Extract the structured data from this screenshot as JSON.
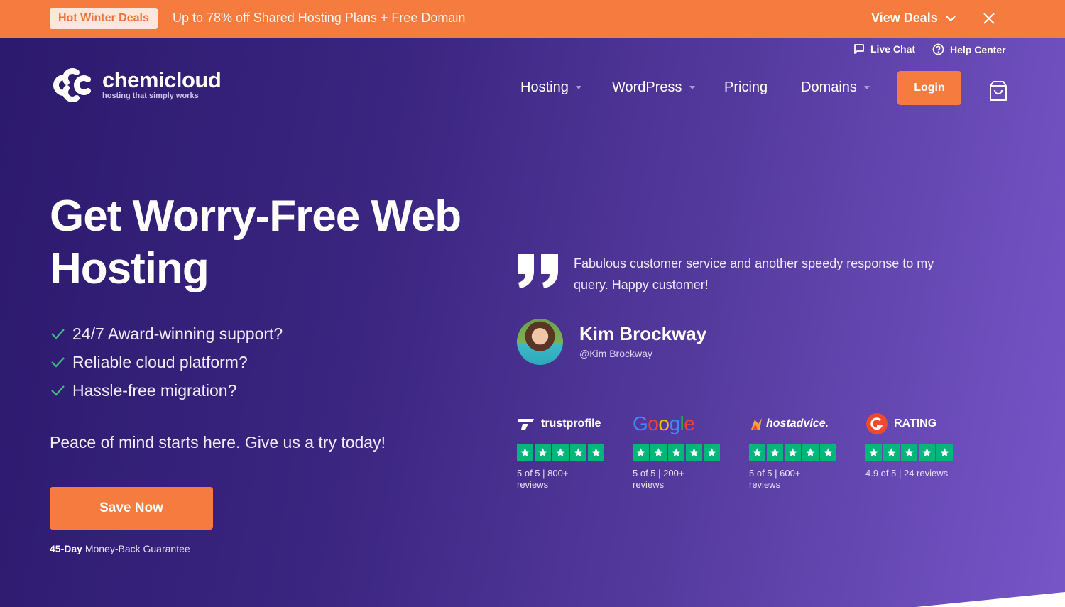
{
  "promo": {
    "badge": "Hot Winter Deals",
    "text": "Up to 78% off Shared Hosting Plans + Free Domain",
    "view_deals": "View Deals",
    "icons": {
      "chevron": "chevron-down-icon",
      "close": "close-icon"
    }
  },
  "utility": {
    "live_chat": "Live Chat",
    "help_center": "Help Center"
  },
  "logo": {
    "name": "chemicloud",
    "tagline": "hosting that simply works"
  },
  "nav": {
    "items": [
      {
        "label": "Hosting",
        "dropdown": true
      },
      {
        "label": "WordPress",
        "dropdown": true
      },
      {
        "label": "Pricing",
        "dropdown": false
      },
      {
        "label": "Domains",
        "dropdown": true
      }
    ],
    "login": "Login",
    "cart_icon": "shopping-bag-icon"
  },
  "hero": {
    "headline": "Get Worry-Free Web Hosting",
    "checks": [
      "24/7 Award-winning support?",
      "Reliable cloud platform?",
      "Hassle-free migration?"
    ],
    "subheadline": "Peace of mind starts here. Give us a try today!",
    "cta": "Save Now",
    "guarantee_bold": "45-Day",
    "guarantee_rest": "Money-Back Guarantee"
  },
  "testimonial": {
    "quote": "Fabulous customer service and another speedy response to my query. Happy customer!",
    "author": "Kim Brockway",
    "handle": "@Kim Brockway"
  },
  "ratings": [
    {
      "source": "trustprofile",
      "stars": 5,
      "score": "5 of 5",
      "count": "800+",
      "unit": "reviews"
    },
    {
      "source": "Google",
      "stars": 5,
      "score": "5 of 5",
      "count": "200+",
      "unit": "reviews"
    },
    {
      "source": "hostadvice.",
      "stars": 5,
      "score": "5 of 5",
      "count": "600+",
      "unit": "reviews"
    },
    {
      "source": "RATING",
      "stars": 5,
      "score": "4.9 of 5",
      "count": "24 reviews",
      "unit": ""
    }
  ],
  "colors": {
    "accent": "#f67b3e",
    "star_green": "#00b67a",
    "bg_start": "#2c1a6e",
    "bg_end": "#7756c8"
  }
}
